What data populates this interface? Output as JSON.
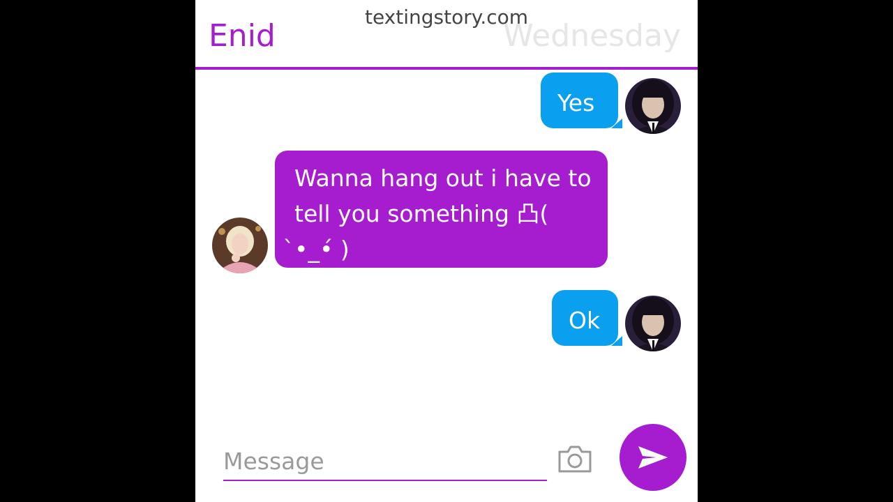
{
  "watermark": "textingstory.com",
  "header": {
    "contact_name": "Enid",
    "self_name": "Wednesday"
  },
  "messages": [
    {
      "sender": "Wednesday",
      "side": "right",
      "text": "Yes",
      "avatar": "wednesday-avatar"
    },
    {
      "sender": "Enid",
      "side": "left",
      "line1": "Wanna hang out i have to",
      "line2": "tell you something 凸( ̀•_•́ )",
      "line3": "凸",
      "avatar": "enid-avatar"
    },
    {
      "sender": "Wednesday",
      "side": "right",
      "text": "Ok",
      "avatar": "wednesday-avatar"
    }
  ],
  "composer": {
    "placeholder": "Message",
    "camera_icon": "camera-icon",
    "send_icon": "send-icon"
  },
  "colors": {
    "accent": "#a61dcf",
    "self_bubble": "#0ba0ef",
    "background": "#000000",
    "panel": "#ffffff"
  }
}
